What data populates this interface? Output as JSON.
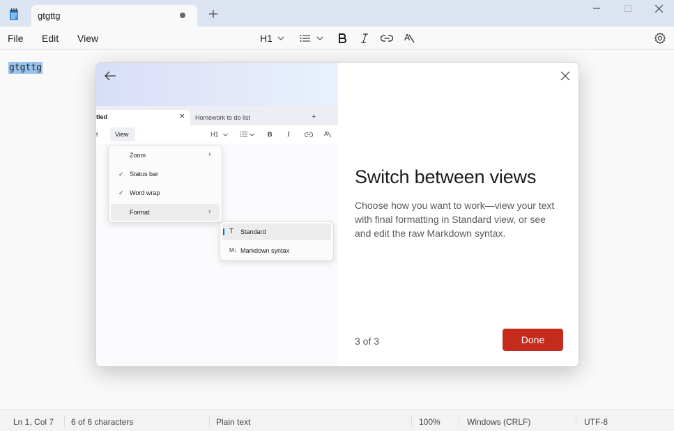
{
  "titlebar": {
    "tab_title": "gtgttg"
  },
  "menubar": {
    "items": [
      "File",
      "Edit",
      "View"
    ],
    "heading_label": "H1",
    "settings_icon": "gear-icon"
  },
  "editor": {
    "text": "gtgttg"
  },
  "dialog": {
    "title": "Switch between views",
    "body": "Choose how you want to work—view your text with final formatting in Standard view, or see and edit the raw Markdown syntax.",
    "page_indicator": "3 of 3",
    "done_label": "Done",
    "accent": "#c42b1c",
    "illustration": {
      "tab_label": "tled",
      "tab2_label": "Homework to do list",
      "menu_partial": "t",
      "view_label": "View",
      "heading_label": "H1",
      "menu_items": [
        {
          "label": "Zoom",
          "checked": false,
          "submenu": true
        },
        {
          "label": "Status bar",
          "checked": true,
          "submenu": false
        },
        {
          "label": "Word wrap",
          "checked": true,
          "submenu": false
        },
        {
          "label": "Format",
          "checked": false,
          "submenu": true
        }
      ],
      "submenu_items": [
        {
          "label": "Standard",
          "icon": "T",
          "selected": true
        },
        {
          "label": "Markdown syntax",
          "icon": "M↓",
          "selected": false
        }
      ],
      "check_glyph": "✓",
      "arrow_glyph": "›"
    }
  },
  "statusbar": {
    "position": "Ln 1, Col 7",
    "characters": "6 of 6 characters",
    "format": "Plain text",
    "zoom": "100%",
    "line_ending": "Windows (CRLF)",
    "encoding": "UTF-8"
  }
}
